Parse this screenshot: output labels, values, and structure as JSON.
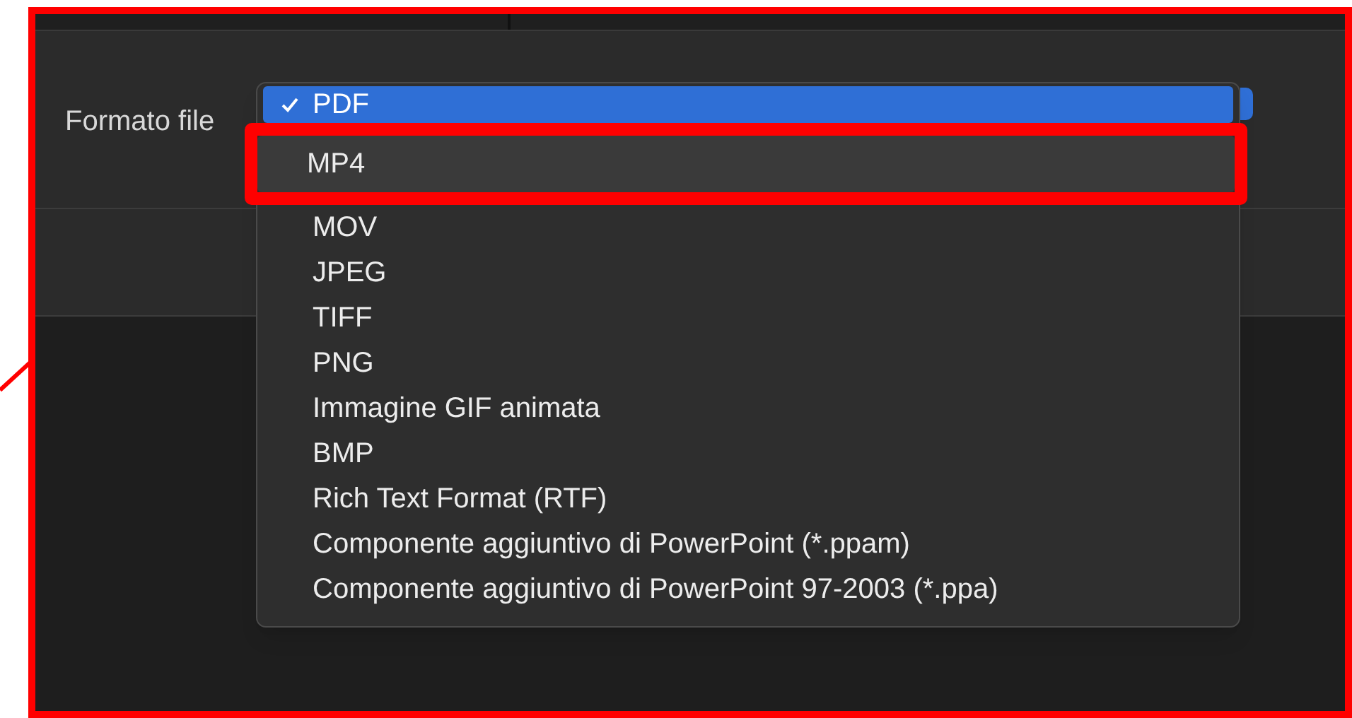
{
  "field": {
    "label": "Formato file"
  },
  "menu": {
    "items": [
      {
        "label": "PDF",
        "checked": true,
        "selected": true,
        "boxed": false
      },
      {
        "label": "MP4",
        "checked": false,
        "selected": false,
        "boxed": true
      },
      {
        "label": "MOV",
        "checked": false,
        "selected": false,
        "boxed": false
      },
      {
        "label": "JPEG",
        "checked": false,
        "selected": false,
        "boxed": false
      },
      {
        "label": "TIFF",
        "checked": false,
        "selected": false,
        "boxed": false
      },
      {
        "label": "PNG",
        "checked": false,
        "selected": false,
        "boxed": false
      },
      {
        "label": "Immagine GIF animata",
        "checked": false,
        "selected": false,
        "boxed": false
      },
      {
        "label": "BMP",
        "checked": false,
        "selected": false,
        "boxed": false
      },
      {
        "label": "Rich Text Format (RTF)",
        "checked": false,
        "selected": false,
        "boxed": false
      },
      {
        "label": "Componente aggiuntivo di PowerPoint (*.ppam)",
        "checked": false,
        "selected": false,
        "boxed": false
      },
      {
        "label": "Componente aggiuntivo di PowerPoint 97-2003 (*.ppa)",
        "checked": false,
        "selected": false,
        "boxed": false
      }
    ]
  }
}
